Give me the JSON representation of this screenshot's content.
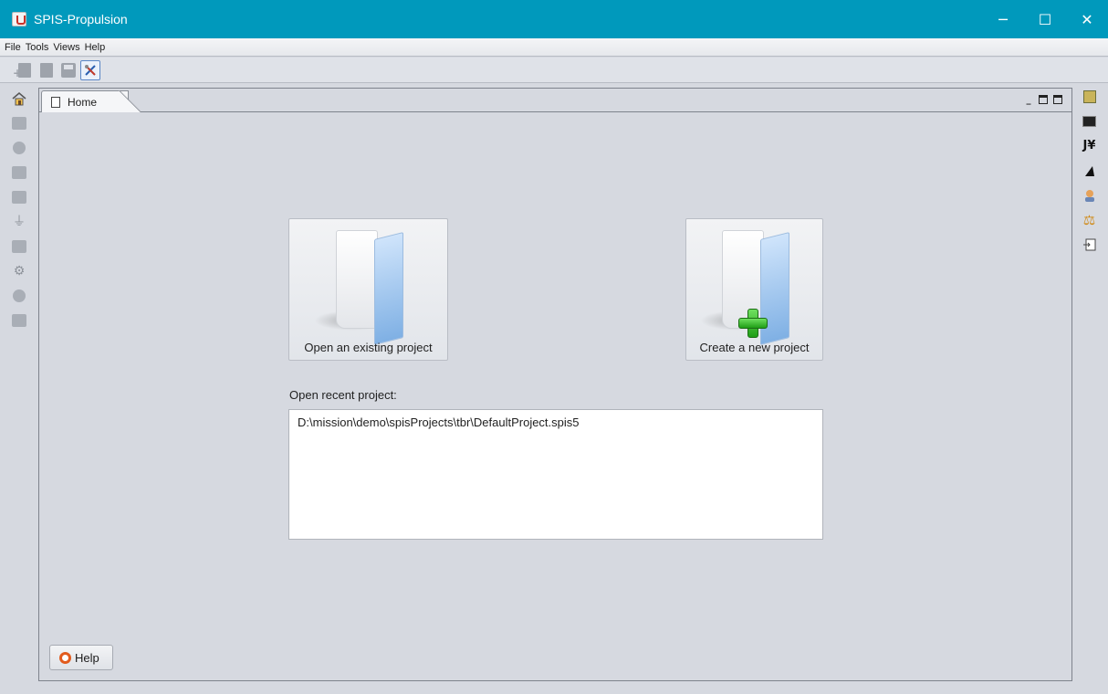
{
  "window": {
    "title": "SPIS-Propulsion",
    "minimize_glyph": "─",
    "maximize_glyph": "☐",
    "close_glyph": "✕"
  },
  "menu": [
    "File",
    "Tools",
    "Views",
    "Help"
  ],
  "toolbar": {
    "items": [
      "new-project-icon",
      "open-project-icon",
      "save-icon",
      "tools-icon"
    ]
  },
  "left_sidebar": {
    "icons": [
      "home-icon",
      "geometry-icon",
      "cad-icon",
      "mesh-icon",
      "groups-icon",
      "ground-icon",
      "fields-icon",
      "settings-icon",
      "simulation-icon",
      "chart-icon"
    ]
  },
  "right_sidebar": {
    "icons": [
      "grid-icon",
      "terminal-icon",
      "jython-icon",
      "plot-icon",
      "user-icon",
      "scale-icon",
      "export-icon"
    ],
    "jython_text": "J¥"
  },
  "tab": {
    "label": "Home"
  },
  "home": {
    "open_button_label": "Open an existing project",
    "create_button_label": "Create a new project",
    "recent_label": "Open recent project:",
    "recent_projects": [
      "D:\\mission\\demo\\spisProjects\\tbr\\DefaultProject.spis5"
    ],
    "help_label": "Help"
  },
  "colors": {
    "titlebar": "#0099bc",
    "background": "#d6d9e0"
  }
}
